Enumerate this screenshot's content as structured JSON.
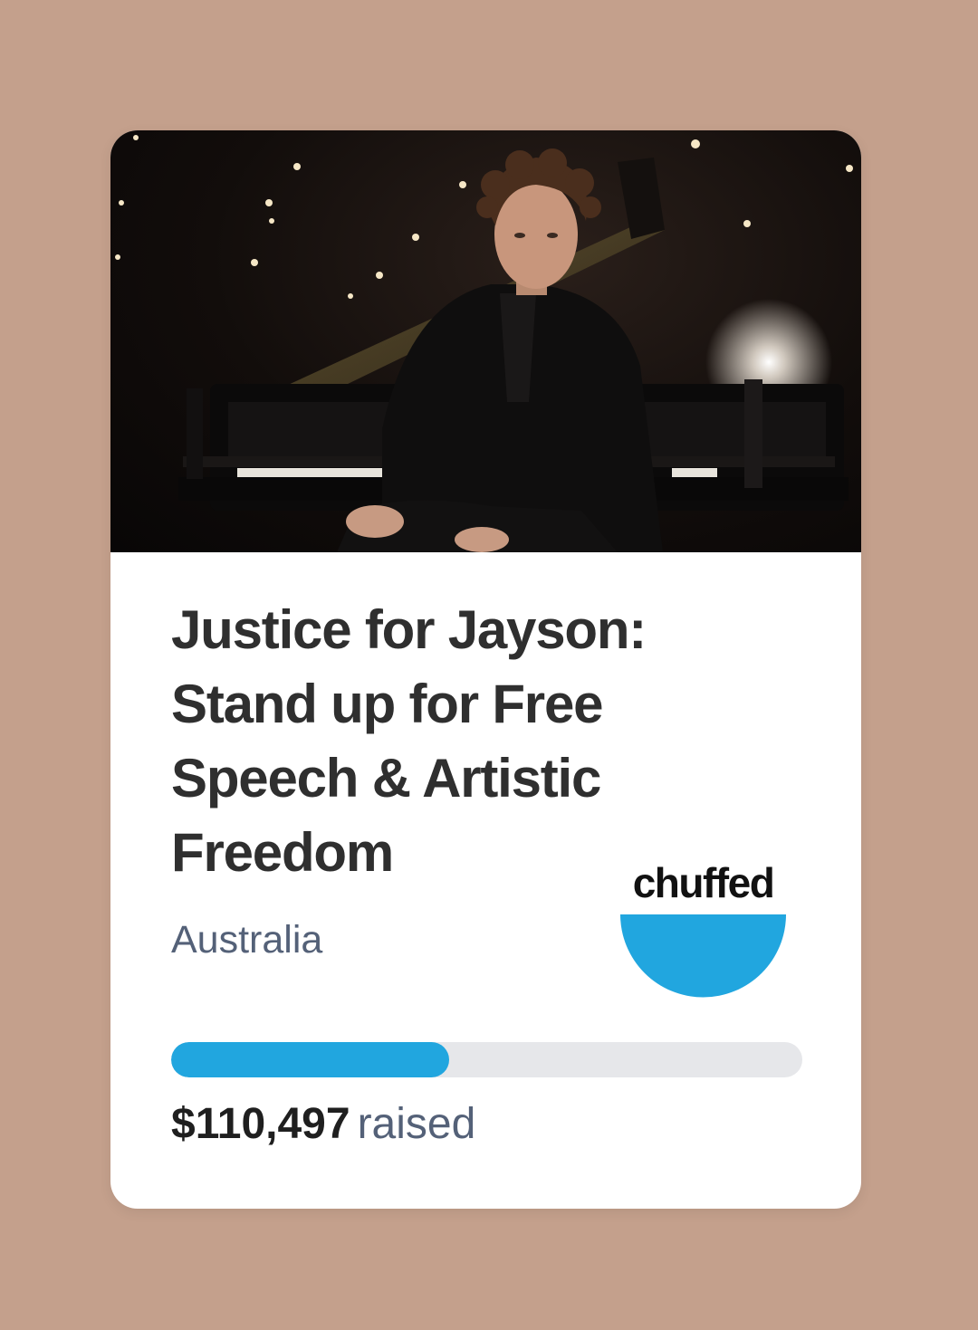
{
  "card": {
    "title": "Justice for Jayson: Stand up for Free Speech & Artistic Freedom",
    "location": "Australia",
    "brand": {
      "name": "chuffed",
      "color": "#21a6df"
    },
    "progress": {
      "fraction": 0.44,
      "color": "#21a6df"
    },
    "amount_raised": "$110,497",
    "raised_label": "raised",
    "image": {
      "description_icon": "campaign-photo"
    }
  },
  "colors": {
    "background": "#c4a08c",
    "card": "#ffffff",
    "title": "#2f2f2f",
    "secondary_text": "#546178",
    "progress_track": "#e6e7ea"
  }
}
